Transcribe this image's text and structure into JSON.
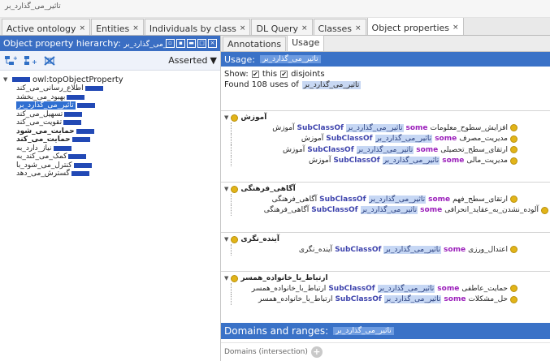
{
  "breadcrumb": "تاثیر_می_گذارد_بر",
  "tabs": [
    {
      "label": "Active ontology",
      "close": "×"
    },
    {
      "label": "Entities",
      "close": "×"
    },
    {
      "label": "Individuals by class",
      "close": "×"
    },
    {
      "label": "DL Query",
      "close": "×"
    },
    {
      "label": "Classes",
      "close": "×"
    },
    {
      "label": "Object properties",
      "close": "×"
    }
  ],
  "left_panel": {
    "title": "Object property hierarchy:",
    "title_entity": "تاثیر_می_گذارد_بر",
    "asserted_label": "Asserted",
    "tree": {
      "root": "owl:topObjectProperty",
      "items": [
        {
          "label": "اطلاع_رسانی_می_کند"
        },
        {
          "label": "بهبود_می_بخشد"
        },
        {
          "label": "تاثیر_می_گذارد_بر"
        },
        {
          "label": "تسهیل_می_کند"
        },
        {
          "label": "تقویت_می_کند"
        },
        {
          "label": "حمایت_می_شود"
        },
        {
          "label": "حمایت_می_کند"
        },
        {
          "label": "نیاز_دارد_به"
        },
        {
          "label": "کمک_می_کند_به"
        },
        {
          "label": "کنترل_می_شود_با"
        },
        {
          "label": "گسترش_می_دهد"
        }
      ]
    }
  },
  "right_panel": {
    "tabs": [
      "Annotations",
      "Usage"
    ],
    "usage_title": "Usage:",
    "usage_entity": "تاثیر_می_گذارد_بر",
    "show_label": "Show:",
    "this_label": "this",
    "disjoints_label": "disjoints",
    "found_text": "Found 108 uses of",
    "found_entity": "تاثیر_می_گذارد_بر",
    "keyword_some": "some",
    "keyword_subclassof": "SubClassOf",
    "property": "تاثیر_می_گذارد_بر",
    "groups": [
      {
        "name": "آموزش",
        "axioms": [
          {
            "subject": "افزایش_سطوح_معلومات",
            "object": "آموزش"
          },
          {
            "subject": "مدیریت_مصرف",
            "object": "آموزش"
          },
          {
            "subject": "ارتقای_سطح_تحصیلی",
            "object": "آموزش"
          },
          {
            "subject": "مدیریت_مالی",
            "object": "آموزش"
          }
        ]
      },
      {
        "name": "آگاهی_فرهنگی",
        "axioms": [
          {
            "subject": "ارتقای_سطح_فهم",
            "object": "آگاهی_فرهنگی"
          },
          {
            "subject": "آلوده_نشدن_به_عقاید_انحرافی",
            "object": "آگاهی_فرهنگی"
          }
        ]
      },
      {
        "name": "آینده_نگری",
        "axioms": [
          {
            "subject": "اعتدال_ورزی",
            "object": "آینده_نگری"
          }
        ]
      },
      {
        "name": "ارتباط_با_خانواده_همسر",
        "axioms": [
          {
            "subject": "حمایت_عاطفی",
            "object": "ارتباط_با_خانواده_همسر"
          },
          {
            "subject": "حل_مشکلات",
            "object": "ارتباط_با_خانواده_همسر"
          }
        ]
      }
    ],
    "domains_title": "Domains and ranges:",
    "domains_entity": "تاثیر_می_گذارد_بر",
    "domains_intersection_label": "Domains (intersection)"
  }
}
